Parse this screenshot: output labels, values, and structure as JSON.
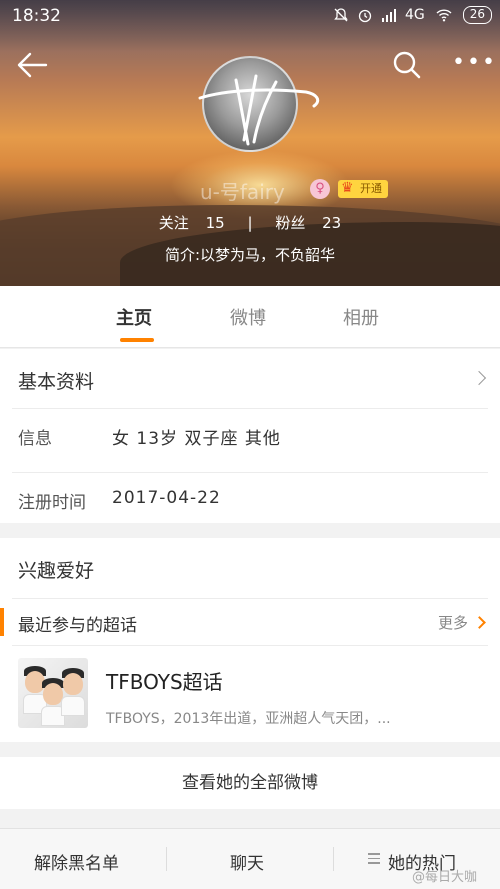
{
  "status_bar": {
    "time": "18:32",
    "network": "4G",
    "battery": "26"
  },
  "profile": {
    "username": "u-号fairy",
    "gender_symbol": "♀",
    "vip_label": "开通",
    "following_label": "关注",
    "following_count": "15",
    "separator": "|",
    "followers_label": "粉丝",
    "followers_count": "23",
    "bio": "简介:以梦为马，不负韶华"
  },
  "tabs": [
    {
      "label": "主页",
      "active": true
    },
    {
      "label": "微博",
      "active": false
    },
    {
      "label": "相册",
      "active": false
    }
  ],
  "basic_info": {
    "title": "基本资料",
    "info_label": "信息",
    "info_value": "女  13岁  双子座  其他",
    "register_label": "注册时间",
    "register_value": "2017-04-22"
  },
  "interests": {
    "title": "兴趣爱好",
    "recent_topics_label": "最近参与的超话",
    "more_label": "更多",
    "topic": {
      "title": "TFBOYS超话",
      "description": "TFBOYS，2013年出道，亚洲超人气天团，..."
    }
  },
  "view_all": "查看她的全部微博",
  "bottom_bar": {
    "unblock": "解除黑名单",
    "chat": "聊天",
    "hot": "她的热门"
  },
  "watermark": "@每日大咖",
  "colors": {
    "accent": "#ff8200",
    "vip": "#ffd43f"
  }
}
